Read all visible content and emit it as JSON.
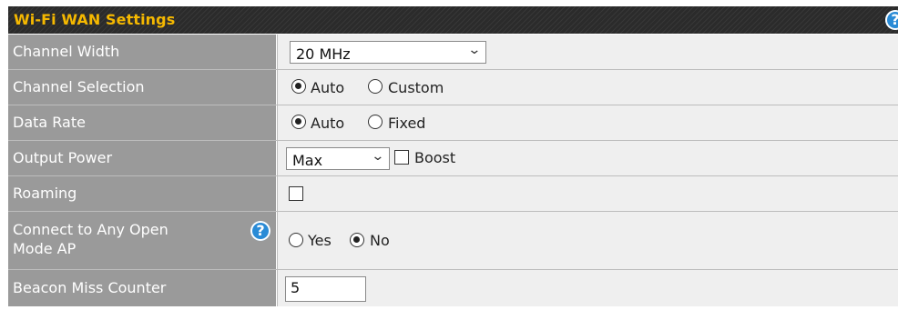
{
  "header": {
    "title": "Wi-Fi WAN Settings",
    "help_label": "?"
  },
  "rows": {
    "channel_width": {
      "label": "Channel Width",
      "value": "20 MHz"
    },
    "channel_selection": {
      "label": "Channel Selection",
      "options": [
        "Auto",
        "Custom"
      ],
      "selected": "Auto"
    },
    "data_rate": {
      "label": "Data Rate",
      "options": [
        "Auto",
        "Fixed"
      ],
      "selected": "Auto"
    },
    "output_power": {
      "label": "Output Power",
      "value": "Max",
      "boost_label": "Boost"
    },
    "roaming": {
      "label": "Roaming"
    },
    "connect_open": {
      "label_line1": "Connect to Any Open",
      "label_line2": "Mode AP",
      "help_label": "?",
      "options": [
        "Yes",
        "No"
      ],
      "selected": "No"
    },
    "beacon_miss": {
      "label": "Beacon Miss Counter",
      "value": "5"
    }
  },
  "colors": {
    "header_bg": "#2b2b2b",
    "header_text": "#f5b800",
    "label_bg": "#9a9a9a",
    "value_bg": "#efefef",
    "help": "#2a8bd6"
  },
  "icons": {
    "chevron": "chevron-down-icon",
    "help": "help-icon"
  }
}
